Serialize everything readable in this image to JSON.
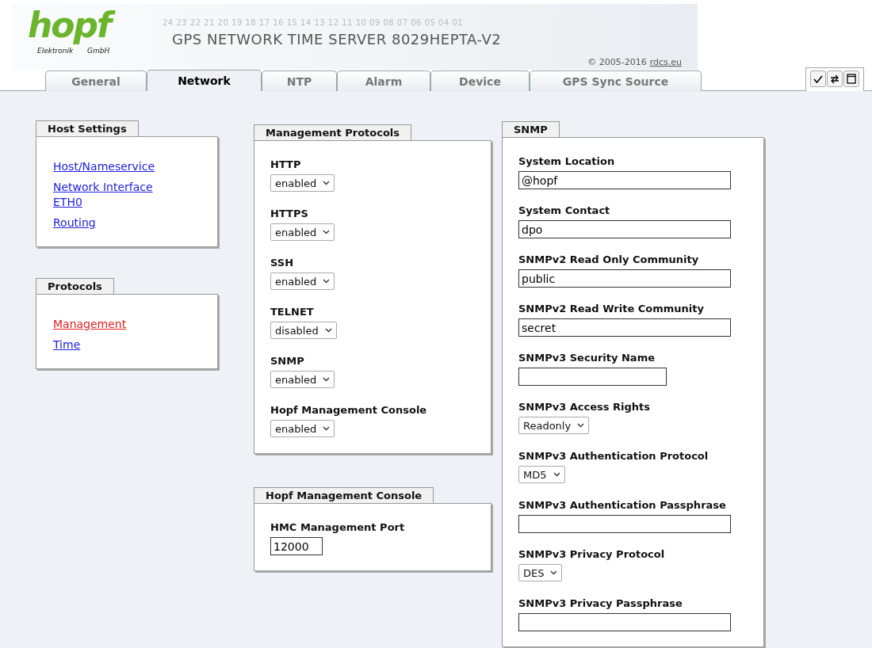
{
  "header": {
    "logo": "hopf",
    "logo_left": "Elektronik",
    "logo_right": "GmbH",
    "scale": "24 23 22 21 20 19 18 17 16 15 14 13 12 11 10 09 08 07 06 05 04 01",
    "title": "GPS NETWORK TIME SERVER 8029HEPTA-V2",
    "copyright": "© 2005-2016",
    "copyright_link": "rdcs.eu"
  },
  "tabs": [
    {
      "label": "General",
      "selected": false
    },
    {
      "label": "Network",
      "selected": true
    },
    {
      "label": "NTP",
      "selected": false
    },
    {
      "label": "Alarm",
      "selected": false
    },
    {
      "label": "Device",
      "selected": false
    },
    {
      "label": "GPS Sync Source",
      "selected": false
    }
  ],
  "left_boxes": [
    {
      "title": "Host Settings",
      "links": [
        {
          "label": "Host/Nameservice",
          "selected": false
        },
        {
          "label": "Network Interface ETH0",
          "selected": false
        },
        {
          "label": "Routing",
          "selected": false
        }
      ]
    },
    {
      "title": "Protocols",
      "links": [
        {
          "label": "Management",
          "selected": true
        },
        {
          "label": "Time",
          "selected": false
        }
      ]
    }
  ],
  "middle_boxes": [
    {
      "title": "Management Protocols",
      "fields": [
        {
          "label": "HTTP",
          "kind": "select",
          "value": "enabled"
        },
        {
          "label": "HTTPS",
          "kind": "select",
          "value": "enabled"
        },
        {
          "label": "SSH",
          "kind": "select",
          "value": "enabled"
        },
        {
          "label": "TELNET",
          "kind": "select",
          "value": "disabled"
        },
        {
          "label": "SNMP",
          "kind": "select",
          "value": "enabled"
        },
        {
          "label": "Hopf Management Console",
          "kind": "select",
          "value": "enabled"
        }
      ]
    },
    {
      "title": "Hopf Management Console",
      "fields": [
        {
          "label": "HMC Management Port",
          "kind": "short",
          "value": "12000"
        }
      ]
    }
  ],
  "snmp": {
    "title": "SNMP",
    "fields": [
      {
        "label": "System Location",
        "kind": "text",
        "value": "@hopf"
      },
      {
        "label": "System Contact",
        "kind": "text",
        "value": "dpo"
      },
      {
        "label": "SNMPv2 Read Only Community",
        "kind": "text",
        "value": "public"
      },
      {
        "label": "SNMPv2 Read Write Community",
        "kind": "text",
        "value": "secret"
      },
      {
        "label": "SNMPv3 Security Name",
        "kind": "medium"
      },
      {
        "label": "SNMPv3 Access Rights",
        "kind": "select",
        "value": "Readonly"
      },
      {
        "label": "SNMPv3 Authentication Protocol",
        "kind": "select",
        "value": "MD5"
      },
      {
        "label": "SNMPv3 Authentication Passphrase",
        "kind": "text"
      },
      {
        "label": "SNMPv3 Privacy Protocol",
        "kind": "select",
        "value": "DES"
      },
      {
        "label": "SNMPv3 Privacy Passphrase",
        "kind": "text"
      }
    ]
  }
}
